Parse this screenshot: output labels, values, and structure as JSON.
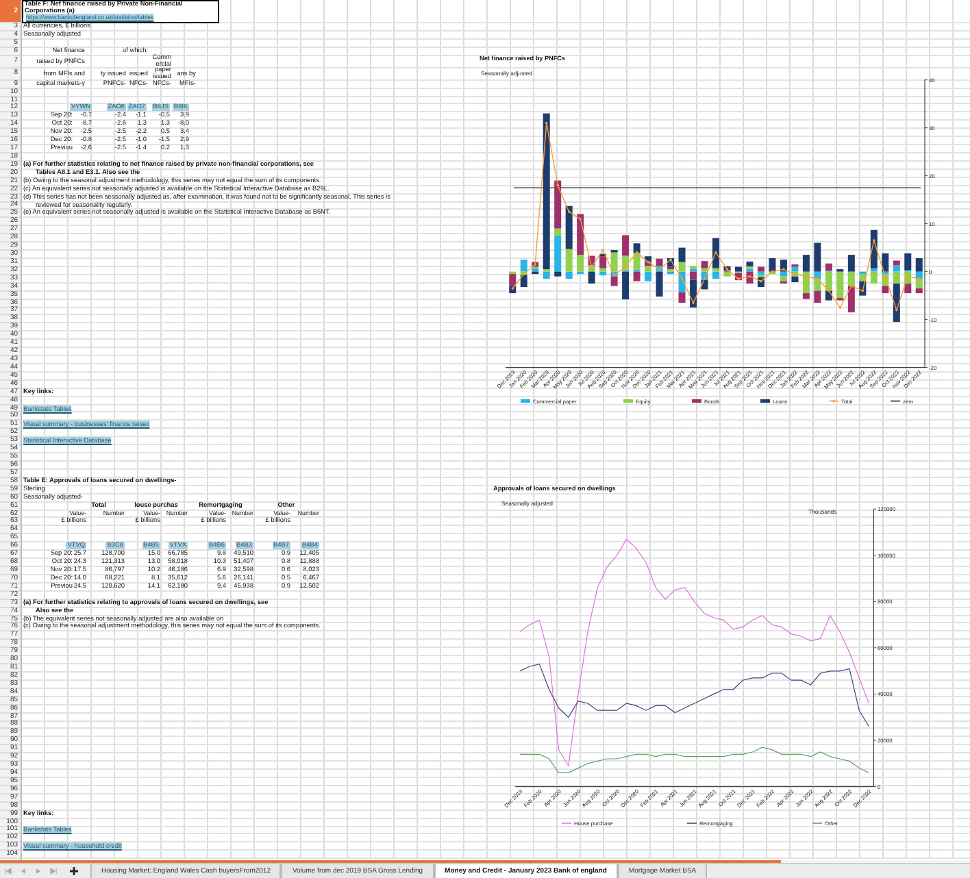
{
  "sheet": {
    "rows": [
      {
        "n": "2",
        "selected": true,
        "kind": "title",
        "cells": [
          "Table F: Net finance raised by Private Non-Financial Corporations (a)",
          "https://www.bankofengland.co.uk/statistics/tables"
        ]
      },
      {
        "n": "3",
        "selected": false,
        "kind": "note",
        "cells": [
          "All currencies, £ billions"
        ]
      },
      {
        "n": "4",
        "selected": false,
        "kind": "note",
        "cells": [
          "Seasonally adjusted"
        ]
      },
      {
        "n": "5",
        "selected": false
      },
      {
        "n": "6",
        "selected": false,
        "kind": "f_head",
        "cells": [
          "Net finance",
          null,
          "of which:",
          null,
          null
        ]
      },
      {
        "n": "7",
        "selected": false,
        "kind": "f_head_wrap",
        "cells": [
          "raised by PNFCs",
          null,
          null,
          "Comm ercial",
          null
        ]
      },
      {
        "n": "8",
        "selected": false,
        "kind": "f_head_wrap",
        "cells": [
          "from MFIs and",
          "ty issued",
          "issued",
          "paper issued",
          "ans by"
        ]
      },
      {
        "n": "9",
        "selected": false,
        "kind": "f_head",
        "cells": [
          "capital markets-y",
          "PNFCs-",
          "NFCs-",
          "NFCs-",
          "MFIs-"
        ]
      },
      {
        "n": "10",
        "selected": false
      },
      {
        "n": "11",
        "selected": false
      },
      {
        "n": "12",
        "selected": false,
        "kind": "f_codes",
        "cells": [
          null,
          "VYWN",
          "ZAO6",
          "ZAO7",
          "B8JS",
          "B8IK"
        ]
      },
      {
        "n": "13",
        "selected": false,
        "kind": "f_values",
        "cells": [
          "Sep 20:",
          "-0.7",
          "-2.4",
          "-1.1",
          "-0.5",
          "3.9"
        ]
      },
      {
        "n": "14",
        "selected": false,
        "kind": "f_values",
        "cells": [
          "Oct 20:",
          "-8.7",
          "-2.6",
          "1.3",
          "1.3",
          "-8.0"
        ]
      },
      {
        "n": "15",
        "selected": false,
        "kind": "f_values",
        "cells": [
          "Nov 20:",
          "-2.5",
          "-2.5",
          "-2.2",
          "0.5",
          "3.4"
        ]
      },
      {
        "n": "16",
        "selected": false,
        "kind": "f_values",
        "cells": [
          "Dec 20:",
          "-0.8",
          "-2.5",
          "-1.0",
          "-1.5",
          "2.9"
        ]
      },
      {
        "n": "17",
        "selected": false,
        "kind": "f_values",
        "cells": [
          "Previou",
          "-2.6",
          "-2.5",
          "-1.4",
          "0.2",
          "1.3"
        ]
      },
      {
        "n": "18",
        "selected": false
      },
      {
        "n": "19",
        "selected": false,
        "kind": "bold_note",
        "cells": [
          "(a) For further statistics relating to net finance raised by private non-financial corporations, see"
        ]
      },
      {
        "n": "20",
        "selected": false,
        "kind": "bold_note_indent",
        "cells": [
          "Tables A8.1 and E3.1. Also see the"
        ]
      },
      {
        "n": "21",
        "selected": false,
        "kind": "note",
        "cells": [
          "(b) Owing to the seasonal adjustment methodology, this series may not equal the sum of its components."
        ]
      },
      {
        "n": "22",
        "selected": false,
        "kind": "note",
        "cells": [
          "(c) An equivalent series not seasonally adjusted is available on the Statistical Interactive Database as B29L."
        ]
      },
      {
        "n": "23",
        "selected": false,
        "kind": "note",
        "cells": [
          "(d) This series has not been seasonally adjusted as, after examination, it was found not to be significantly seasonal. This series is"
        ]
      },
      {
        "n": "24",
        "selected": false,
        "kind": "note_indent",
        "cells": [
          "reviewed for seasonality regularly."
        ]
      },
      {
        "n": "25",
        "selected": false,
        "kind": "note",
        "cells": [
          "(e) An equivalent series not seasonally adjusted is available on the Statistical Interactive Database as B6NT."
        ]
      },
      {
        "n": "26",
        "selected": false
      },
      {
        "n": "27",
        "selected": false
      },
      {
        "n": "28",
        "selected": false
      },
      {
        "n": "29",
        "selected": false
      },
      {
        "n": "30",
        "selected": false
      },
      {
        "n": "31",
        "selected": false
      },
      {
        "n": "32",
        "selected": false
      },
      {
        "n": "33",
        "selected": false
      },
      {
        "n": "34",
        "selected": false
      },
      {
        "n": "35",
        "selected": false
      },
      {
        "n": "36",
        "selected": false
      },
      {
        "n": "37",
        "selected": false
      },
      {
        "n": "38",
        "selected": false
      },
      {
        "n": "39",
        "selected": false
      },
      {
        "n": "40",
        "selected": false
      },
      {
        "n": "41",
        "selected": false
      },
      {
        "n": "42",
        "selected": false
      },
      {
        "n": "43",
        "selected": false
      },
      {
        "n": "44",
        "selected": false
      },
      {
        "n": "45",
        "selected": false
      },
      {
        "n": "46",
        "selected": false
      },
      {
        "n": "47",
        "selected": false,
        "kind": "bold_note",
        "cells": [
          "Key links:"
        ]
      },
      {
        "n": "48",
        "selected": false
      },
      {
        "n": "49",
        "selected": false,
        "kind": "link",
        "cells": [
          "Bankstats Tables"
        ]
      },
      {
        "n": "50",
        "selected": false
      },
      {
        "n": "51",
        "selected": false,
        "kind": "link",
        "cells": [
          "Visual summary - businesses' finance raised"
        ]
      },
      {
        "n": "52",
        "selected": false
      },
      {
        "n": "53",
        "selected": false,
        "kind": "link",
        "cells": [
          "Statistical Interactive Database"
        ]
      },
      {
        "n": "54",
        "selected": false
      },
      {
        "n": "55",
        "selected": false
      },
      {
        "n": "56",
        "selected": false
      },
      {
        "n": "57",
        "selected": false
      },
      {
        "n": "58",
        "selected": false,
        "kind": "bold_note",
        "cells": [
          "Table E: Approvals of loans secured on dwellings-"
        ]
      },
      {
        "n": "59",
        "selected": false,
        "kind": "note",
        "cells": [
          "Sterling"
        ]
      },
      {
        "n": "60",
        "selected": false,
        "kind": "note",
        "cells": [
          "Seasonally adjusted-"
        ]
      },
      {
        "n": "61",
        "selected": false,
        "kind": "e_head",
        "cells": [
          null,
          "Total",
          "louse purchas",
          "Remortgaging",
          "Other"
        ]
      },
      {
        "n": "62",
        "selected": false,
        "kind": "e_sub",
        "cells": [
          null,
          "Value-",
          "Number",
          "Value-",
          "Number",
          "Value-",
          "Number",
          "Value-",
          "Number"
        ]
      },
      {
        "n": "63",
        "selected": false,
        "kind": "e_unit",
        "cells": [
          null,
          "£ billions",
          null,
          "£ billions",
          null,
          "£ billions",
          null,
          "£ billions",
          null
        ]
      },
      {
        "n": "64",
        "selected": false
      },
      {
        "n": "65",
        "selected": false
      },
      {
        "n": "66",
        "selected": false,
        "kind": "e_codes",
        "cells": [
          null,
          "VTVQ",
          "B3C8",
          "B4B5",
          "VTVX",
          "B4B6",
          "B4B3",
          "B4B7",
          "B4B4"
        ]
      },
      {
        "n": "67",
        "selected": false,
        "kind": "e_values",
        "cells": [
          "Sep 20:",
          "25.7",
          "128,700",
          "15.0",
          "66,785",
          "9.8",
          "49,510",
          "0.9",
          "12,405"
        ]
      },
      {
        "n": "68",
        "selected": false,
        "kind": "e_values",
        "cells": [
          "Oct 20:",
          "24.3",
          "121,313",
          "13.0",
          "58,018",
          "10.3",
          "51,407",
          "0.8",
          "11,888"
        ]
      },
      {
        "n": "69",
        "selected": false,
        "kind": "e_values",
        "cells": [
          "Nov 20:",
          "17.5",
          "86,797",
          "10.2",
          "46,186",
          "6.9",
          "32,598",
          "0.6",
          "8,023"
        ]
      },
      {
        "n": "70",
        "selected": false,
        "kind": "e_values",
        "cells": [
          "Dec 20:",
          "14.0",
          "68,221",
          "8.1",
          "35,612",
          "5.6",
          "26,141",
          "0.5",
          "6,467"
        ]
      },
      {
        "n": "71",
        "selected": false,
        "kind": "e_values",
        "cells": [
          "Previou",
          "24.5",
          "120,620",
          "14.1",
          "62,180",
          "9.4",
          "45,938",
          "0.9",
          "12,502"
        ]
      },
      {
        "n": "72",
        "selected": false
      },
      {
        "n": "73",
        "selected": false,
        "kind": "bold_note",
        "cells": [
          "(a) For further statistics relating to approvals of loans secured on dwellings, see"
        ]
      },
      {
        "n": "74",
        "selected": false,
        "kind": "bold_note_indent",
        "cells": [
          "Also see the"
        ]
      },
      {
        "n": "75",
        "selected": false,
        "kind": "note",
        "cells": [
          "(b) The equivalent series not seasonally adjusted are also available on"
        ]
      },
      {
        "n": "76",
        "selected": false,
        "kind": "note",
        "cells": [
          "(c) Owing to the seasonal adjustment methodology, this series may not equal the sum of its components."
        ]
      },
      {
        "n": "77",
        "selected": false
      },
      {
        "n": "78",
        "selected": false
      },
      {
        "n": "79",
        "selected": false
      },
      {
        "n": "80",
        "selected": false
      },
      {
        "n": "81",
        "selected": false
      },
      {
        "n": "82",
        "selected": false
      },
      {
        "n": "83",
        "selected": false
      },
      {
        "n": "84",
        "selected": false
      },
      {
        "n": "85",
        "selected": false
      },
      {
        "n": "86",
        "selected": false
      },
      {
        "n": "87",
        "selected": false
      },
      {
        "n": "88",
        "selected": false
      },
      {
        "n": "89",
        "selected": false
      },
      {
        "n": "90",
        "selected": false
      },
      {
        "n": "91",
        "selected": false
      },
      {
        "n": "92",
        "selected": false
      },
      {
        "n": "93",
        "selected": false
      },
      {
        "n": "94",
        "selected": false
      },
      {
        "n": "95",
        "selected": false
      },
      {
        "n": "96",
        "selected": false
      },
      {
        "n": "97",
        "selected": false
      },
      {
        "n": "98",
        "selected": false
      },
      {
        "n": "99",
        "selected": false,
        "kind": "bold_note",
        "cells": [
          "Key links:"
        ]
      },
      {
        "n": "100",
        "selected": false
      },
      {
        "n": "101",
        "selected": false,
        "kind": "link",
        "cells": [
          "Bankstats Tables"
        ]
      },
      {
        "n": "102",
        "selected": false
      },
      {
        "n": "103",
        "selected": false,
        "kind": "link",
        "cells": [
          "Visual summary - household credit"
        ]
      },
      {
        "n": "104",
        "selected": false
      }
    ]
  },
  "charts": [
    {
      "subtitle": "Seasonally adjusted",
      "chart_data": {
        "type": "bar",
        "stacked": true,
        "title": "Net finance raised by PNFCs",
        "categories": [
          "Dec 2019",
          "Jan 2020",
          "Feb 2020",
          "Mar 2020",
          "Apr 2020",
          "May 2020",
          "Jun 2020",
          "Jul 2020",
          "Aug 2020",
          "Sep 2020",
          "Oct 2020",
          "Nov 2020",
          "Dec 2020",
          "Jan 2021",
          "Feb 2021",
          "Mar 2021",
          "Apr 2021",
          "May 2021",
          "Jun 2021",
          "Jul 2021",
          "Aug 2021",
          "Sep 2021",
          "Oct 2021",
          "Nov 2021",
          "Dec 2021",
          "Jan 2022",
          "Feb 2022",
          "Mar 2022",
          "Apr 2022",
          "May 2022",
          "Jun 2022",
          "Jul 2022",
          "Aug 2022",
          "Sep 2022",
          "Oct 2022",
          "Nov 2022",
          "Dec 2022"
        ],
        "ylim": [
          -20,
          40
        ],
        "yticks": [
          -20,
          -10,
          0,
          10,
          20,
          30,
          40
        ],
        "series": [
          {
            "name": "Commercial paper",
            "type": "bar",
            "color": "#29b5e8",
            "values": [
              null,
              2.5,
              0.7,
              -1.5,
              7.5,
              -1.5,
              -0.5,
              0,
              -0.8,
              -1,
              0.3,
              0.4,
              -2,
              1.2,
              -0.5,
              -4.3,
              0.6,
              -1.7,
              -1.5,
              0,
              0,
              0.6,
              -0.7,
              0,
              -1,
              1,
              0,
              -1.5,
              0.2,
              0,
              0,
              -0.5,
              0.7,
              -0.5,
              1.3,
              0.3,
              -1.5
            ]
          },
          {
            "name": "Equity",
            "type": "bar",
            "color": "#92d050",
            "values": [
              -0.5,
              -0.7,
              0.3,
              0.5,
              1.5,
              4.7,
              3.5,
              1.3,
              0.7,
              4,
              3,
              3.5,
              1.2,
              0,
              0.5,
              2,
              0.6,
              0.7,
              0.7,
              -1,
              -0.3,
              0.5,
              -0.5,
              -0.5,
              -1,
              -1,
              -4.5,
              -2.5,
              -4,
              -5.5,
              -3,
              -1.5,
              -2.5,
              -2.5,
              -2.5,
              -2.5,
              -2
            ]
          },
          {
            "name": "Bonds",
            "type": "bar",
            "color": "#a0306a",
            "values": [
              -2.5,
              0,
              1,
              0,
              10,
              0,
              8.5,
              2,
              2.5,
              -2,
              4.3,
              -2,
              1,
              1.5,
              0.5,
              -2.2,
              -1.7,
              1.5,
              0,
              0.3,
              -1.5,
              -2.5,
              1,
              0,
              -0.5,
              0.5,
              -1.2,
              -2.5,
              1.5,
              -0.5,
              -5.5,
              0,
              0,
              -1.5,
              1,
              -2,
              -1
            ]
          },
          {
            "name": "Loans",
            "type": "bar",
            "color": "#1f3c6e",
            "values": [
              -1.5,
              -2.5,
              -0.5,
              32.5,
              -1,
              9,
              0,
              -2.5,
              0.5,
              0.5,
              -5.8,
              2,
              1,
              -5.2,
              1.8,
              3,
              -5.8,
              -2,
              6.3,
              0.8,
              1,
              1,
              -2,
              2.8,
              2.5,
              -1.2,
              3.5,
              6,
              -2,
              0.5,
              3.5,
              -3,
              8,
              3.8,
              -8,
              3.5,
              2.8
            ]
          },
          {
            "name": "Total",
            "type": "line",
            "color": "#f5a030",
            "values": [
              -3.5,
              -0.5,
              1.5,
              31,
              18,
              12.5,
              11,
              1,
              4.5,
              -0.7,
              1,
              4,
              2,
              0.5,
              2.5,
              -1.5,
              -6.5,
              -1.5,
              4,
              0.5,
              -1.5,
              -1,
              -2,
              0,
              0.5,
              -0.5,
              -1,
              -1.5,
              -4,
              -7.5,
              -3,
              -4,
              6.5,
              -1,
              -8,
              -1,
              -1.5
            ]
          }
        ],
        "ref_lines": [
          {
            "axis": "y",
            "value": 17.5,
            "label": "zero",
            "color": "#222222"
          }
        ],
        "legend": "bottom"
      }
    },
    {
      "subtitle": "Seasonally adjusted",
      "chart_data": {
        "type": "line",
        "title": "Approvals of loans secured on dwellings",
        "ylabel": "Thousands",
        "ylim": [
          0,
          120000
        ],
        "yticks": [
          0,
          20000,
          40000,
          60000,
          80000,
          100000,
          120000
        ],
        "legend": "bottom",
        "categories": [
          "Dec 2019",
          null,
          "Feb 2020",
          null,
          "Apr 2020",
          null,
          "Jun 2020",
          null,
          "Aug 2020",
          null,
          "Oct 2020",
          null,
          "Dec 2020",
          null,
          "Feb 2021",
          null,
          "Apr 2021",
          null,
          "Jun 2021",
          null,
          "Aug 2021",
          null,
          "Oct 2021",
          null,
          "Dec 2021",
          null,
          "Feb 2022",
          null,
          "Apr 2022",
          null,
          "Jun 2022",
          null,
          "Aug 2022",
          null,
          "Oct 2022",
          null,
          "Dec 2022"
        ],
        "series": [
          {
            "name": "House purchase",
            "color": "#e070e0",
            "values": [
              67000,
              70000,
              72000,
              56000,
              16000,
              9000,
              40000,
              67000,
              86000,
              95000,
              100000,
              107000,
              103000,
              97000,
              86000,
              81000,
              85000,
              86000,
              80000,
              75000,
              73000,
              72000,
              68000,
              69000,
              72000,
              74000,
              70000,
              69000,
              66000,
              65000,
              63000,
              64000,
              74000,
              67000,
              58000,
              47000,
              36000
            ]
          },
          {
            "name": "Remortgaging",
            "color": "#404080",
            "values": [
              50000,
              52000,
              53000,
              42000,
              34000,
              30000,
              37000,
              36000,
              33000,
              33000,
              33000,
              36000,
              35000,
              33000,
              35000,
              35000,
              32000,
              34000,
              36000,
              38000,
              40000,
              42000,
              42000,
              46000,
              47000,
              47000,
              49000,
              49000,
              46000,
              46000,
              44000,
              49000,
              50000,
              50000,
              51000,
              33000,
              26000
            ]
          },
          {
            "name": "Other",
            "color": "#60a060",
            "values": [
              14000,
              14000,
              14000,
              12000,
              6000,
              6000,
              8000,
              10000,
              11000,
              12000,
              12000,
              13000,
              14000,
              14000,
              13000,
              14000,
              14000,
              13000,
              13000,
              13000,
              13000,
              13000,
              14000,
              14000,
              15000,
              17000,
              16000,
              14000,
              14000,
              14000,
              13000,
              15000,
              13000,
              12000,
              11000,
              8000,
              6000
            ]
          }
        ]
      }
    }
  ],
  "sheet_tabs": [
    {
      "label": "Housing Market: England Wales Cash buyersFrom2012",
      "selected": false
    },
    {
      "label": "Volume from dec 2019 BSA Gross Lending",
      "selected": false
    },
    {
      "label": "Money and Credit - January 2023 Bank of england",
      "selected": true
    },
    {
      "label": "Mortgage Market BSA",
      "selected": false
    }
  ]
}
